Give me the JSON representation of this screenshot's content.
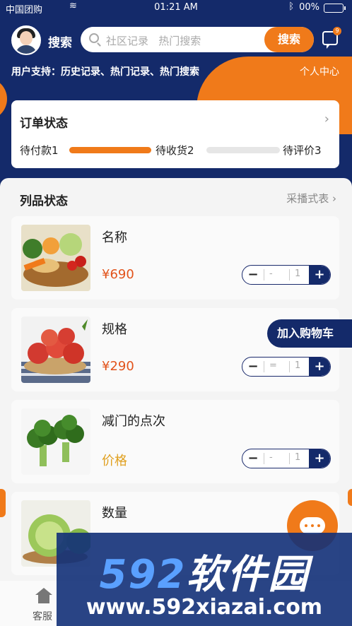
{
  "status_bar": {
    "carrier": "中国团购",
    "time": "01:21 AM",
    "battery": "00%"
  },
  "header": {
    "search_label": "搜索",
    "search_placeholder": "社区记录   热门搜索",
    "search_button": "搜索",
    "message_badge": "9",
    "support_text": "用户支持：历史记录、热门记录、热门搜索",
    "personal_center": "个人中心"
  },
  "order_status": {
    "title": "订单状态",
    "steps": [
      {
        "label": "待付款1",
        "progress": 1.0
      },
      {
        "label": "待收货2",
        "progress": 0.0
      },
      {
        "label": "待评价3"
      }
    ]
  },
  "product_list": {
    "title": "列品状态",
    "more": "采播式表 ›",
    "items": [
      {
        "name": "名称",
        "price": "¥690",
        "qty": "1",
        "dash": "-",
        "image": "vegetable-basket"
      },
      {
        "name": "规格",
        "price": "¥290",
        "qty": "1",
        "dash": "=",
        "image": "apples"
      },
      {
        "name": "减门的点次",
        "price": "价格",
        "qty": "1",
        "dash": "-",
        "image": "broccoli"
      },
      {
        "name": "数量",
        "price": "",
        "qty": "",
        "dash": "",
        "image": "cabbage"
      }
    ],
    "add_to_cart": "加入购物车"
  },
  "bottom_nav": {
    "service": "客服"
  },
  "watermark": {
    "brand_num": "592",
    "brand_text": "软件园",
    "url": "www.592xiazai.com"
  },
  "colors": {
    "navy": "#142a6a",
    "orange": "#f07a1a",
    "price_red": "#e2531b"
  }
}
